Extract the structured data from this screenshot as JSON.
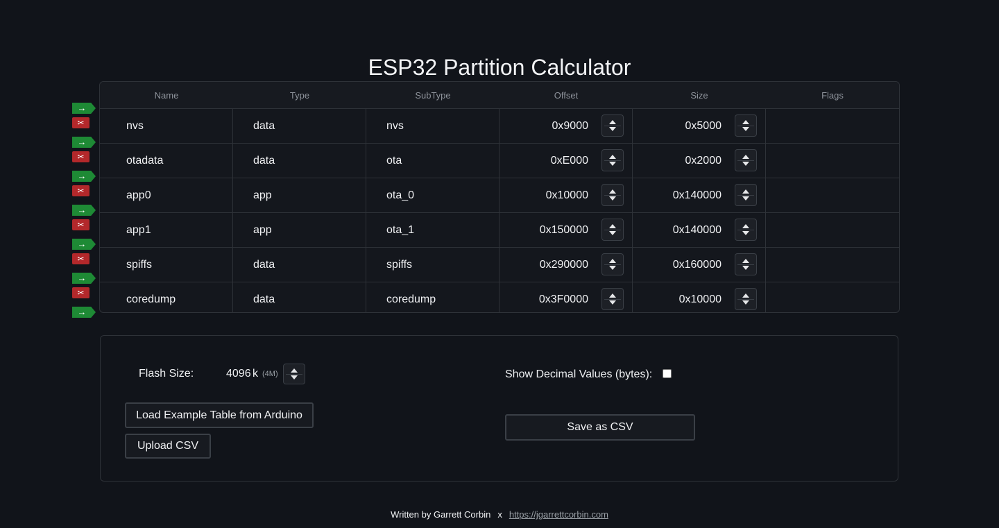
{
  "title": "ESP32 Partition Calculator",
  "table": {
    "headers": [
      "Name",
      "Type",
      "SubType",
      "Offset",
      "Size",
      "Flags"
    ],
    "rows": [
      {
        "name": "nvs",
        "type": "data",
        "subtype": "nvs",
        "offset": "0x9000",
        "size": "0x5000",
        "flags": ""
      },
      {
        "name": "otadata",
        "type": "data",
        "subtype": "ota",
        "offset": "0xE000",
        "size": "0x2000",
        "flags": ""
      },
      {
        "name": "app0",
        "type": "app",
        "subtype": "ota_0",
        "offset": "0x10000",
        "size": "0x140000",
        "flags": ""
      },
      {
        "name": "app1",
        "type": "app",
        "subtype": "ota_1",
        "offset": "0x150000",
        "size": "0x140000",
        "flags": ""
      },
      {
        "name": "spiffs",
        "type": "data",
        "subtype": "spiffs",
        "offset": "0x290000",
        "size": "0x160000",
        "flags": ""
      },
      {
        "name": "coredump",
        "type": "data",
        "subtype": "coredump",
        "offset": "0x3F0000",
        "size": "0x10000",
        "flags": ""
      }
    ]
  },
  "row_buttons": {
    "insert_glyph": "→",
    "delete_glyph": "✂"
  },
  "settings": {
    "flash_label": "Flash Size:",
    "flash_value": "4096",
    "flash_unit": "k",
    "flash_mb": "(4M)",
    "decimal_label": "Show Decimal Values (bytes):",
    "decimal_checked": false,
    "load_example_label": "Load Example Table from Arduino",
    "upload_label": "Upload CSV",
    "save_label": "Save as CSV"
  },
  "footer": {
    "written_by": "Written by Garrett Corbin",
    "separator": "x",
    "link": "https://jgarrettcorbin.com"
  },
  "colors": {
    "background": "#11141a",
    "insert": "#1e8a35",
    "delete": "#b3282b",
    "border": "#2e3238"
  }
}
